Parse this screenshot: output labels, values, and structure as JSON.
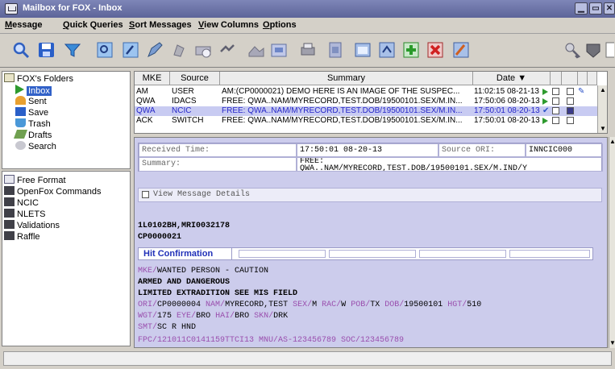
{
  "window": {
    "title": "Mailbox for FOX - Inbox"
  },
  "menu": [
    "Message",
    "Quick Queries",
    "Sort Messages",
    "View Columns",
    "Options"
  ],
  "toolbar_icons": [
    "search-icon",
    "save-icon",
    "filter-icon",
    "view-icon",
    "edit-icon",
    "compose-icon",
    "pen-icon",
    "print-icon",
    "envelope-icon",
    "link-icon",
    "forward-icon",
    "folder-icon",
    "printer-icon",
    "document-icon",
    "window-icon",
    "notes-icon",
    "add-icon",
    "delete-icon",
    "edit-doc-icon",
    "key-icon",
    "shield-icon"
  ],
  "folders": {
    "root": "FOX's Folders",
    "items": [
      "Inbox",
      "Sent",
      "Save",
      "Trash",
      "Drafts",
      "Search"
    ],
    "selected": "Inbox"
  },
  "folders2": {
    "items": [
      "Free Format",
      "OpenFox Commands",
      "NCIC",
      "NLETS",
      "Validations",
      "Raffle"
    ]
  },
  "columns": {
    "mke": "MKE",
    "source": "Source",
    "summary": "Summary",
    "date": "Date ▼"
  },
  "messages": [
    {
      "mke": "AM",
      "source": "USER",
      "summary": "AM:(CP0000021) DEMO HERE IS AN IMAGE OF THE SUSPEC...",
      "date": "11:02:15 08-21-13"
    },
    {
      "mke": "QWA",
      "source": "IDACS",
      "summary": "FREE: QWA..NAM/MYRECORD,TEST.DOB/19500101.SEX/M.IN...",
      "date": "17:50:06 08-20-13"
    },
    {
      "mke": "QWA",
      "source": "NCIC",
      "summary": "FREE: QWA..NAM/MYRECORD,TEST.DOB/19500101.SEX/M.IN...",
      "date": "17:50:01 08-20-13"
    },
    {
      "mke": "ACK",
      "source": "SWITCH",
      "summary": "FREE: QWA..NAM/MYRECORD,TEST.DOB/19500101.SEX/M.IN...",
      "date": "17:50:01 08-20-13"
    }
  ],
  "detail": {
    "received_label": "Received Time:",
    "received_value": "17:50:01 08-20-13",
    "source_label": "Source ORI:",
    "source_value": "INNCIC000",
    "summary_label": "Summary:",
    "summary_line1": "FREE:",
    "summary_line2": "QWA..NAM/MYRECORD,TEST.DOB/19500101.SEX/M.IND/Y",
    "view_details": "View Message Details",
    "line_a": "1L0102BH,MRI0032178",
    "line_b": "CP0000021",
    "hit_label": "Hit Confirmation",
    "mke_tag": "MKE/",
    "mke_val": "WANTED PERSON - CAUTION",
    "armed": "ARMED AND DANGEROUS",
    "limited": "LIMITED EXTRADITION SEE MIS FIELD",
    "l_ori": "ORI/",
    "v_ori": "CP0000004",
    "l_nam": "NAM/",
    "v_nam": "MYRECORD,TEST",
    "l_sex": "SEX/",
    "v_sex": "M",
    "l_rac": "RAC/",
    "v_rac": "W",
    "l_pob": "POB/",
    "v_pob": "TX",
    "l_dob": "DOB/",
    "v_dob": "19500101",
    "l_hgt": "HGT/",
    "v_hgt": "510",
    "l_wgt": "WGT/",
    "v_wgt": "175",
    "l_eye": "EYE/",
    "v_eye": "BRO",
    "l_hai": "HAI/",
    "v_hai": "BRO",
    "l_skn": "SKN/",
    "v_skn": "DRK",
    "l_smt": "SMT/",
    "v_smt": "SC R HND",
    "last_line": "FPC/121011C0141159TTCI13 MNU/AS-123456789 SOC/123456789"
  }
}
